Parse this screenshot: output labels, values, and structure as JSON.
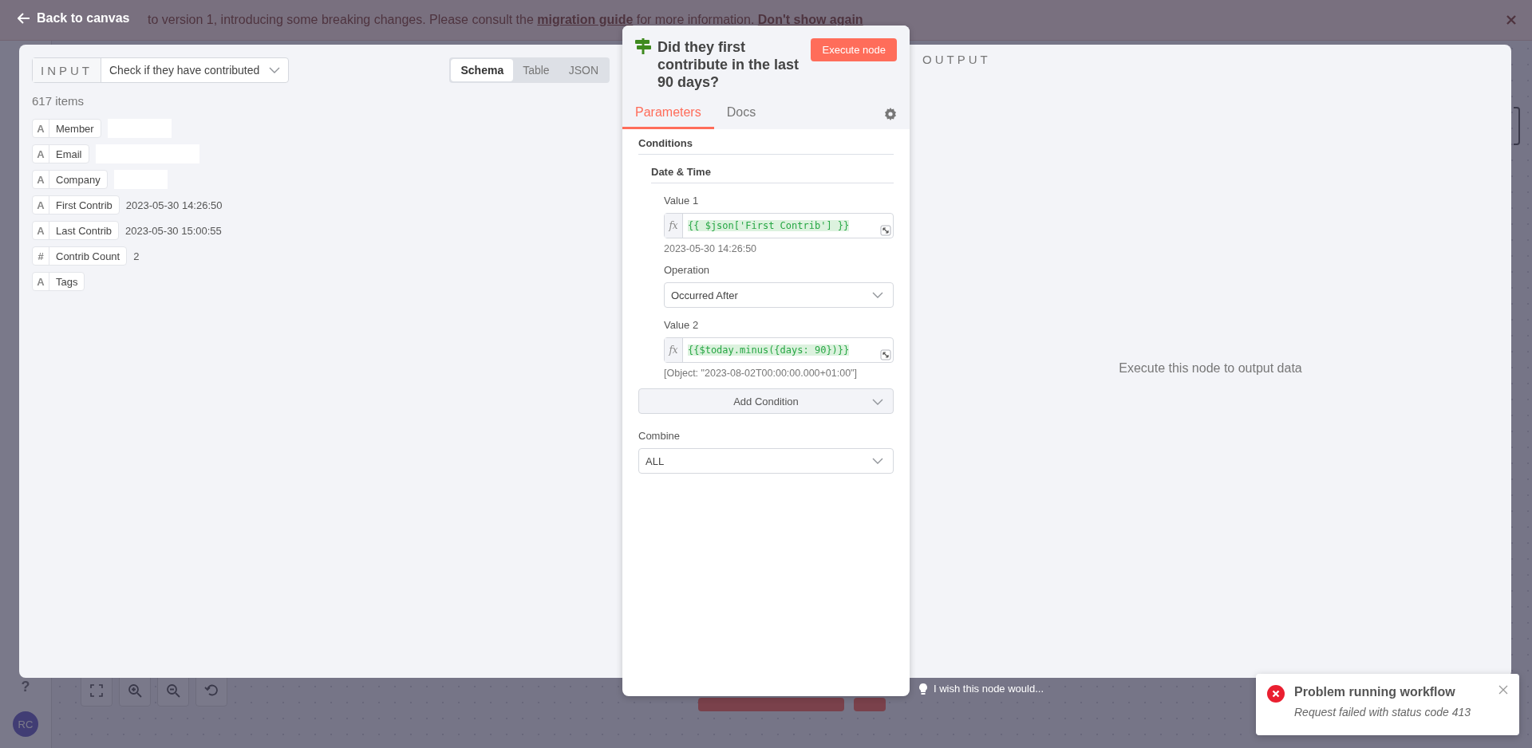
{
  "banner": {
    "message": "to version 1, introducing some breaking changes. Please consult the",
    "link": "migration guide",
    "message_end": "for more information.",
    "dismiss": "Don't show again"
  },
  "canvas": {
    "help": "?",
    "avatar": "RC"
  },
  "back_link": "Back to canvas",
  "input": {
    "label": "INPUT",
    "node_select": "Check if they have contributed",
    "view_tabs": [
      {
        "label": "Schema",
        "selected": true
      },
      {
        "label": "Table",
        "selected": false
      },
      {
        "label": "JSON",
        "selected": false
      }
    ],
    "count": "617 items",
    "fields": [
      {
        "type_icon": "A",
        "name": "Member",
        "kind": "redacted"
      },
      {
        "type_icon": "A",
        "name": "Email",
        "kind": "redacted"
      },
      {
        "type_icon": "A",
        "name": "Company",
        "kind": "redacted"
      },
      {
        "type_icon": "A",
        "name": "First Contrib",
        "kind": "text",
        "value": "2023-05-30 14:26:50"
      },
      {
        "type_icon": "A",
        "name": "Last Contrib",
        "kind": "text",
        "value": "2023-05-30 15:00:55"
      },
      {
        "type_icon": "#",
        "name": "Contrib Count",
        "kind": "text",
        "value": "2"
      },
      {
        "type_icon": "A",
        "name": "Tags",
        "kind": "empty"
      }
    ]
  },
  "node": {
    "title": "Did they first contribute in the last 90 days?",
    "execute_button": "Execute node",
    "tabs": [
      {
        "label": "Parameters",
        "selected": true
      },
      {
        "label": "Docs",
        "selected": false
      }
    ],
    "conditions_label": "Conditions",
    "group_label": "Date & Time",
    "value1": {
      "label": "Value 1",
      "fx": "fx",
      "expression": "{{ $json['First Contrib'] }}",
      "result": "2023-05-30 14:26:50"
    },
    "operation": {
      "label": "Operation",
      "value": "Occurred After"
    },
    "value2": {
      "label": "Value 2",
      "fx": "fx",
      "expression": "{{$today.minus({days: 90})}}",
      "result": "[Object: \"2023-08-02T00:00:00.000+01:00\"]"
    },
    "add_condition": "Add Condition",
    "combine": {
      "label": "Combine",
      "value": "ALL"
    }
  },
  "output": {
    "label": "OUTPUT",
    "empty_message": "Execute this node to output data"
  },
  "feedback": "I wish this node would...",
  "toast": {
    "title": "Problem running workflow",
    "message": "Request failed with status code 413"
  }
}
